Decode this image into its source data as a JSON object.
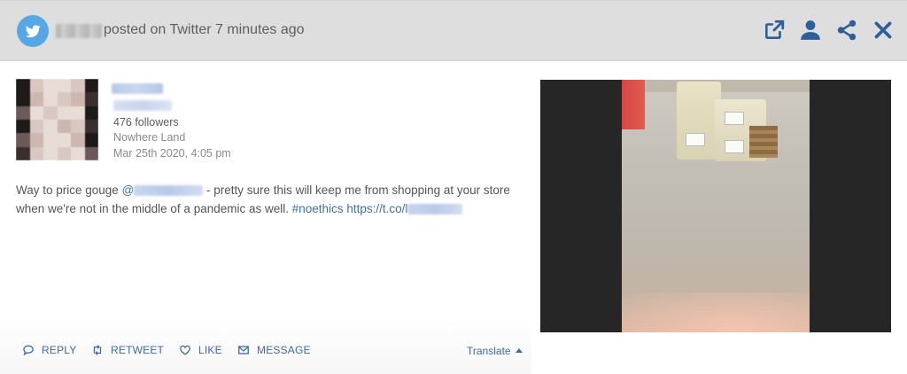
{
  "header": {
    "source_text": "posted on Twitter 7 minutes ago",
    "icons": [
      "twitter-icon",
      "external-link-icon",
      "user-icon",
      "share-icon",
      "close-icon"
    ],
    "background": "#dedede",
    "accent": "#2e5f99"
  },
  "profile": {
    "followers": "476 followers",
    "location": "Nowhere Land",
    "date": "Mar 25th 2020, 4:05 pm"
  },
  "tweet": {
    "prefix": "Way to price gouge ",
    "at": "@",
    "middle": " - pretty sure this will keep me from shopping at your store when we're not in the middle of a pandemic as well. ",
    "hashtag": "#noethics",
    "link_text": "https://t.co/l"
  },
  "actions": {
    "reply": "REPLY",
    "retweet": "RETWEET",
    "like": "LIKE",
    "message": "MESSAGE",
    "translate": "Translate"
  },
  "colors": {
    "link": "#3f69a8",
    "twitter_blue": "#55a7e6"
  }
}
